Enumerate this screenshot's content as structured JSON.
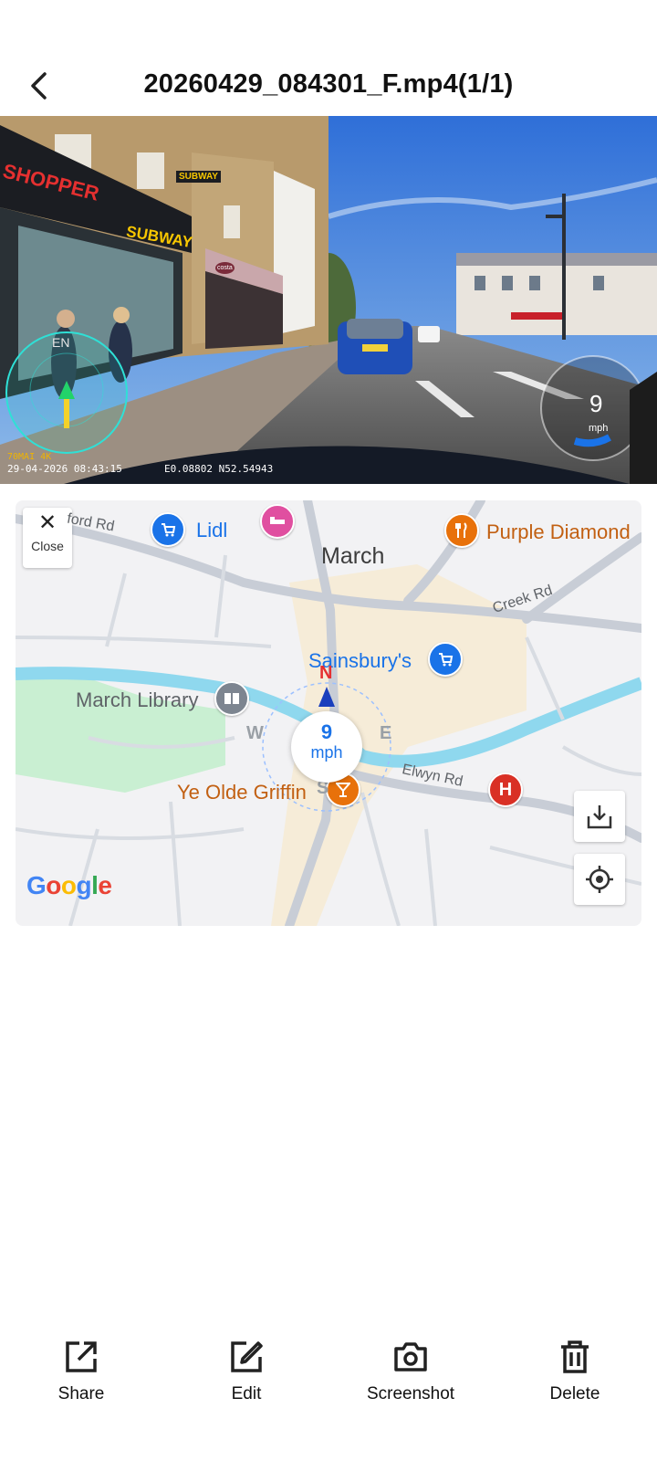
{
  "header": {
    "title": "20260429_084301_F.mp4(1/1)"
  },
  "video": {
    "timestamp": "29-04-2026 08:43:15",
    "gps": "E0.08802 N52.54943",
    "model": "70MAI 4K",
    "speed_value": "9",
    "speed_unit": "mph",
    "shop_sign_1": "SHOPPER",
    "shop_sign_2": "SUBWAY",
    "shop_sign_3": "SUBWAY",
    "shop_sign_4": "costa",
    "en_label": "EN"
  },
  "map": {
    "close_label": "Close",
    "close_icon": "close-icon",
    "labels": {
      "town": "March",
      "lidl": "Lidl",
      "purple_diamond": "Purple Diamond",
      "sainsburys": "Sainsbury's",
      "march_library": "March Library",
      "ye_olde_griffin": "Ye Olde Griffin",
      "road_ford": "ford Rd",
      "road_creek": "Creek Rd",
      "road_elwyn": "Elwyn Rd"
    },
    "speed": {
      "value": "9",
      "unit": "mph"
    },
    "compass": {
      "n": "N",
      "e": "E",
      "s": "S",
      "w": "W"
    },
    "hospital_letter": "H",
    "google": "Google",
    "download_icon": "download-icon",
    "locate_icon": "my-location-icon"
  },
  "toolbar": {
    "items": [
      {
        "label": "Share",
        "icon": "share-icon"
      },
      {
        "label": "Edit",
        "icon": "edit-icon"
      },
      {
        "label": "Screenshot",
        "icon": "camera-icon"
      },
      {
        "label": "Delete",
        "icon": "trash-icon"
      }
    ]
  },
  "colors": {
    "accent_blue": "#1a73e8",
    "orange": "#e8710a",
    "pink": "#e04fa0",
    "red": "#d93025",
    "park_green": "#c9efd2",
    "river": "#8fd8ee"
  }
}
